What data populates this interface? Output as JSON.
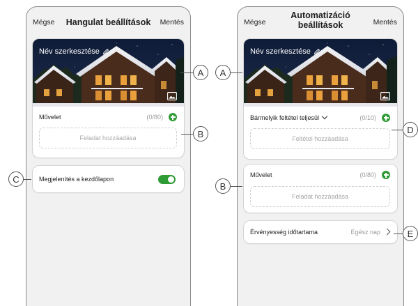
{
  "left_screen": {
    "cancel": "Mégse",
    "title": "Hangulat beállítások",
    "save": "Mentés",
    "name_label": "Név szerkesztése",
    "action": {
      "label": "Művelet",
      "count": "(0/80)",
      "add_text": "Feladat hozzáadása"
    },
    "homepage": {
      "label": "Megjelenítés a kezdőlapon",
      "toggle_on": true
    }
  },
  "right_screen": {
    "cancel": "Mégse",
    "title": "Automatizáció beállítások",
    "save": "Mentés",
    "name_label": "Név szerkesztése",
    "condition": {
      "label": "Bármelyik feltétel teljesül",
      "count": "(0/10)",
      "add_text": "Feltétel hozzáadása"
    },
    "action": {
      "label": "Művelet",
      "count": "(0/80)",
      "add_text": "Feladat hozzáadása"
    },
    "validity": {
      "label": "Érvényesség időtartama",
      "value": "Egész nap"
    }
  },
  "callouts": {
    "a": "A",
    "b": "B",
    "c": "C",
    "d": "D",
    "e": "E"
  },
  "colors": {
    "accent_green": "#2e9b35",
    "phone_bg": "#f1f1f1"
  },
  "icons": [
    "pencil-icon",
    "image-icon",
    "plus-icon",
    "chevron-down-icon",
    "chevron-right-icon"
  ]
}
